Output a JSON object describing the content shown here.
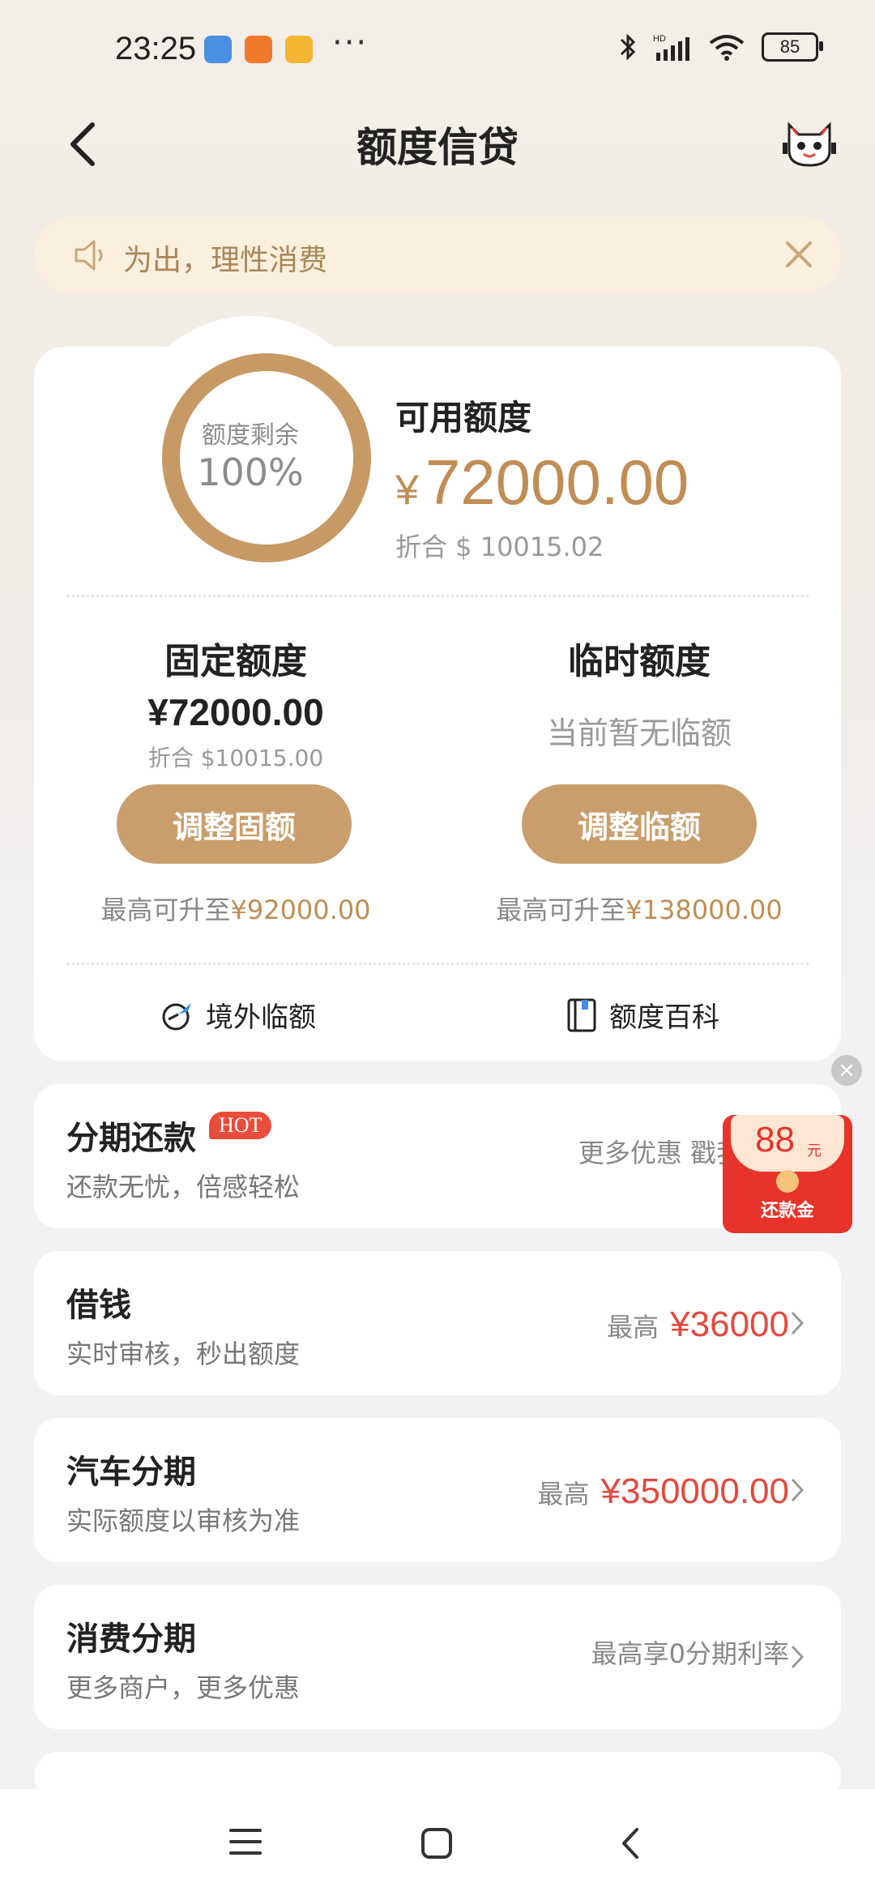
{
  "status_bar": {
    "time": "23:25",
    "more": "···",
    "battery": "85",
    "icons": [
      "app-stocks-icon",
      "app-orange-icon",
      "app-yellow-icon",
      "bluetooth-icon",
      "signal-icon",
      "wifi-icon"
    ]
  },
  "header": {
    "title": "额度信贷",
    "back_icon": "chevron-left-icon",
    "mascot_icon": "mascot-icon"
  },
  "notice": {
    "text": "为出，理性消费",
    "icon": "speaker-icon",
    "close_icon": "close-icon"
  },
  "credit": {
    "ring_label": "额度剩余",
    "ring_percent": "100%",
    "ring_fraction": 1.0,
    "available_label": "可用额度",
    "currency": "¥",
    "available_amount": "72000.00",
    "available_converted": "折合 $ 10015.02",
    "fixed": {
      "title": "固定额度",
      "amount": "¥72000.00",
      "converted": "折合 $10015.00",
      "button": "调整固额",
      "max_prefix": "最高可升至",
      "max_value": "¥92000.00"
    },
    "temp": {
      "title": "临时额度",
      "status": "当前暂无临额",
      "button": "调整临额",
      "max_prefix": "最高可升至",
      "max_value": "¥138000.00"
    },
    "shortcuts": [
      {
        "label": "境外临额",
        "icon": "plane-globe-icon"
      },
      {
        "label": "额度百科",
        "icon": "book-icon"
      }
    ]
  },
  "rows": [
    {
      "title": "分期还款",
      "badge": "HOT",
      "subtitle": "还款无忧，倍感轻松",
      "right_text": "更多优惠 戳我参"
    },
    {
      "title": "借钱",
      "subtitle": "实时审核，秒出额度",
      "right_prefix": "最高",
      "right_value": "¥36000"
    },
    {
      "title": "汽车分期",
      "subtitle": "实际额度以审核为准",
      "right_prefix": "最高",
      "right_value": "¥350000.00"
    },
    {
      "title": "消费分期",
      "subtitle": "更多商户，更多优惠",
      "right_text": "最高享0分期利率"
    }
  ],
  "red_packet": {
    "amount": "88",
    "unit": "元",
    "label": "还款金",
    "close": "×"
  },
  "nav": {
    "icons": [
      "menu-icon",
      "home-icon",
      "back-icon"
    ]
  },
  "colors": {
    "accent": "#c99e6c",
    "accent_text": "#c08d54",
    "red": "#e24a3f",
    "notice_bg": "#fbf0dd"
  }
}
